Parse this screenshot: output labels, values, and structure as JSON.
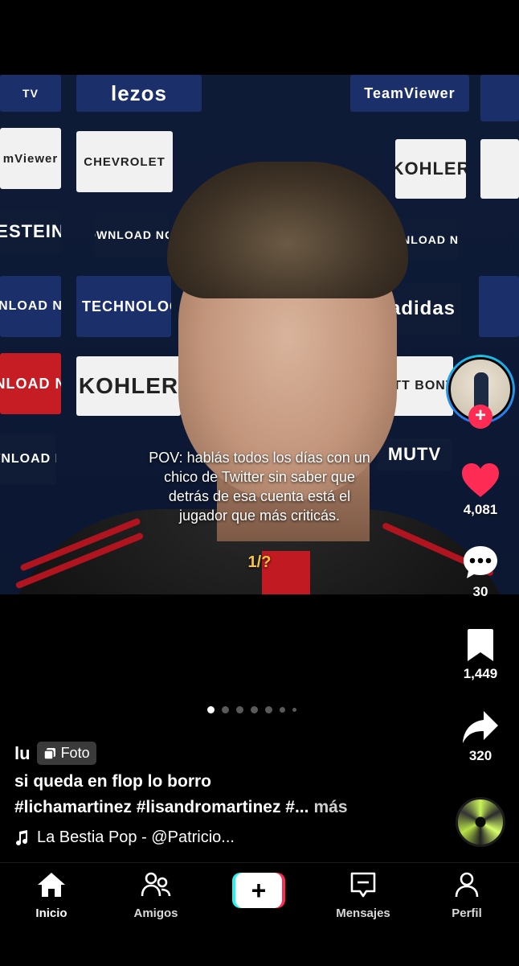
{
  "photo": {
    "sponsor_logos": [
      "lezos",
      "TeamViewer",
      "CHEVROLET",
      "KOHLER",
      "DOWNLOAD NOW",
      "DX TECHNOLOGY",
      "adidas",
      "MARRIOTT BONVOY",
      "MUTV",
      "OLOGY",
      "RIOTT BONVOY",
      "TV",
      "mViewer",
      "ESTEIN",
      "OWNLOAD NOW"
    ],
    "caption": "POV: hablás todos los días con un chico de Twitter sin saber que detrás de esa cuenta está el jugador que más criticás.",
    "caption_sub": "1/?"
  },
  "rail": {
    "likes": "4,081",
    "comments": "30",
    "saves": "1,449",
    "shares": "320",
    "like_color": "#fe2c55",
    "follow_label": "+"
  },
  "pager": {
    "total": 7,
    "active_index": 0
  },
  "post": {
    "author": "lu",
    "type_badge": "Foto",
    "title": "si queda en flop lo borro",
    "hashtags": "#lichamartinez #lisandromartinez #...",
    "more_label": "más",
    "music": "La Bestia Pop - @Patricio..."
  },
  "nav": {
    "items": [
      {
        "label": "Inicio",
        "icon": "home-icon"
      },
      {
        "label": "Amigos",
        "icon": "friends-icon"
      },
      {
        "label": "+",
        "icon": "create-icon"
      },
      {
        "label": "Mensajes",
        "icon": "inbox-icon"
      },
      {
        "label": "Perfil",
        "icon": "profile-icon"
      }
    ]
  }
}
